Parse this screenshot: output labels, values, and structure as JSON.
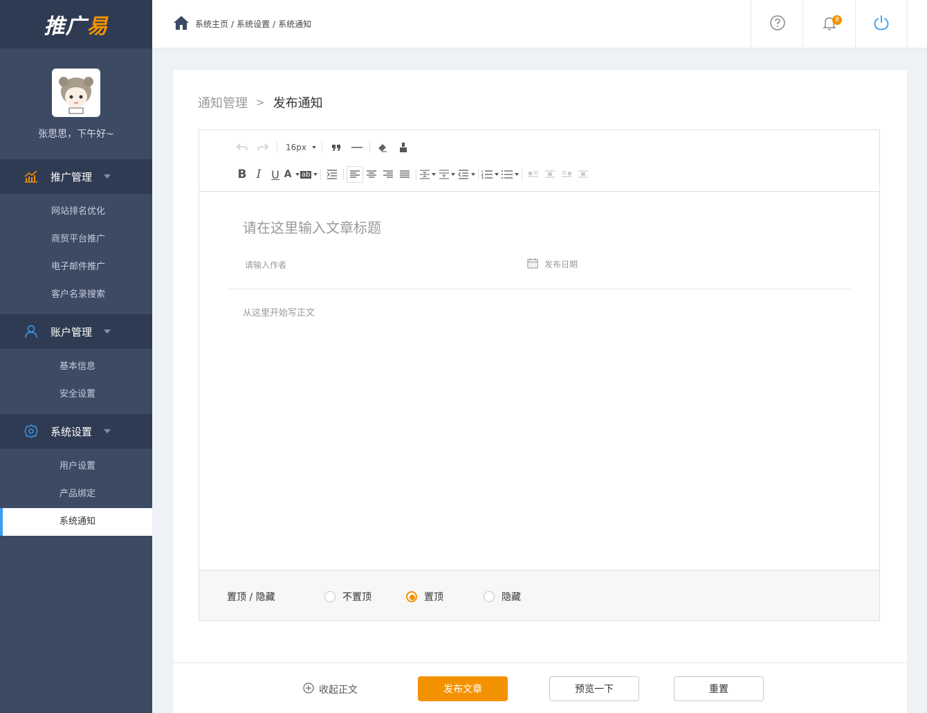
{
  "logo": {
    "text_main": "推广",
    "text_accent": "易"
  },
  "profile": {
    "greeting": "张思思，下午好~"
  },
  "sidebar": {
    "groups": [
      {
        "label": "推广管理",
        "icon": "chart-icon",
        "items": [
          "网站排名优化",
          "商贸平台推广",
          "电子邮件推广",
          "客户名录搜索"
        ]
      },
      {
        "label": "账户管理",
        "icon": "user-icon",
        "items": [
          "基本信息",
          "安全设置"
        ]
      },
      {
        "label": "系统设置",
        "icon": "gear-icon",
        "items": [
          "用户设置",
          "产品绑定",
          "系统通知"
        ]
      }
    ],
    "active_item": "系统通知"
  },
  "header": {
    "breadcrumb": [
      "系统主页",
      "系统设置",
      "系统通知"
    ],
    "breadcrumb_sep": "/",
    "notification_count": "8",
    "icons": [
      "help-icon",
      "bell-icon",
      "power-icon"
    ]
  },
  "page": {
    "parent_title": "通知管理",
    "separator": ">",
    "current_title": "发布通知"
  },
  "editor": {
    "font_size": "16px",
    "title_placeholder": "请在这里输入文章标题",
    "author_placeholder": "请输入作者",
    "date_placeholder": "发布日期",
    "body_placeholder": "从这里开始写正文"
  },
  "options": {
    "label": "置顶 / 隐藏",
    "radios": [
      "不置顶",
      "置顶",
      "隐藏"
    ],
    "selected": "置顶"
  },
  "footer": {
    "collapse_label": "收起正文",
    "publish_label": "发布文章",
    "preview_label": "预览一下",
    "reset_label": "重置"
  },
  "colors": {
    "accent": "#f39200",
    "sidebar": "#3d4a64",
    "sidebar_dark": "#2f3b52",
    "active_bar": "#3b9cf1"
  }
}
